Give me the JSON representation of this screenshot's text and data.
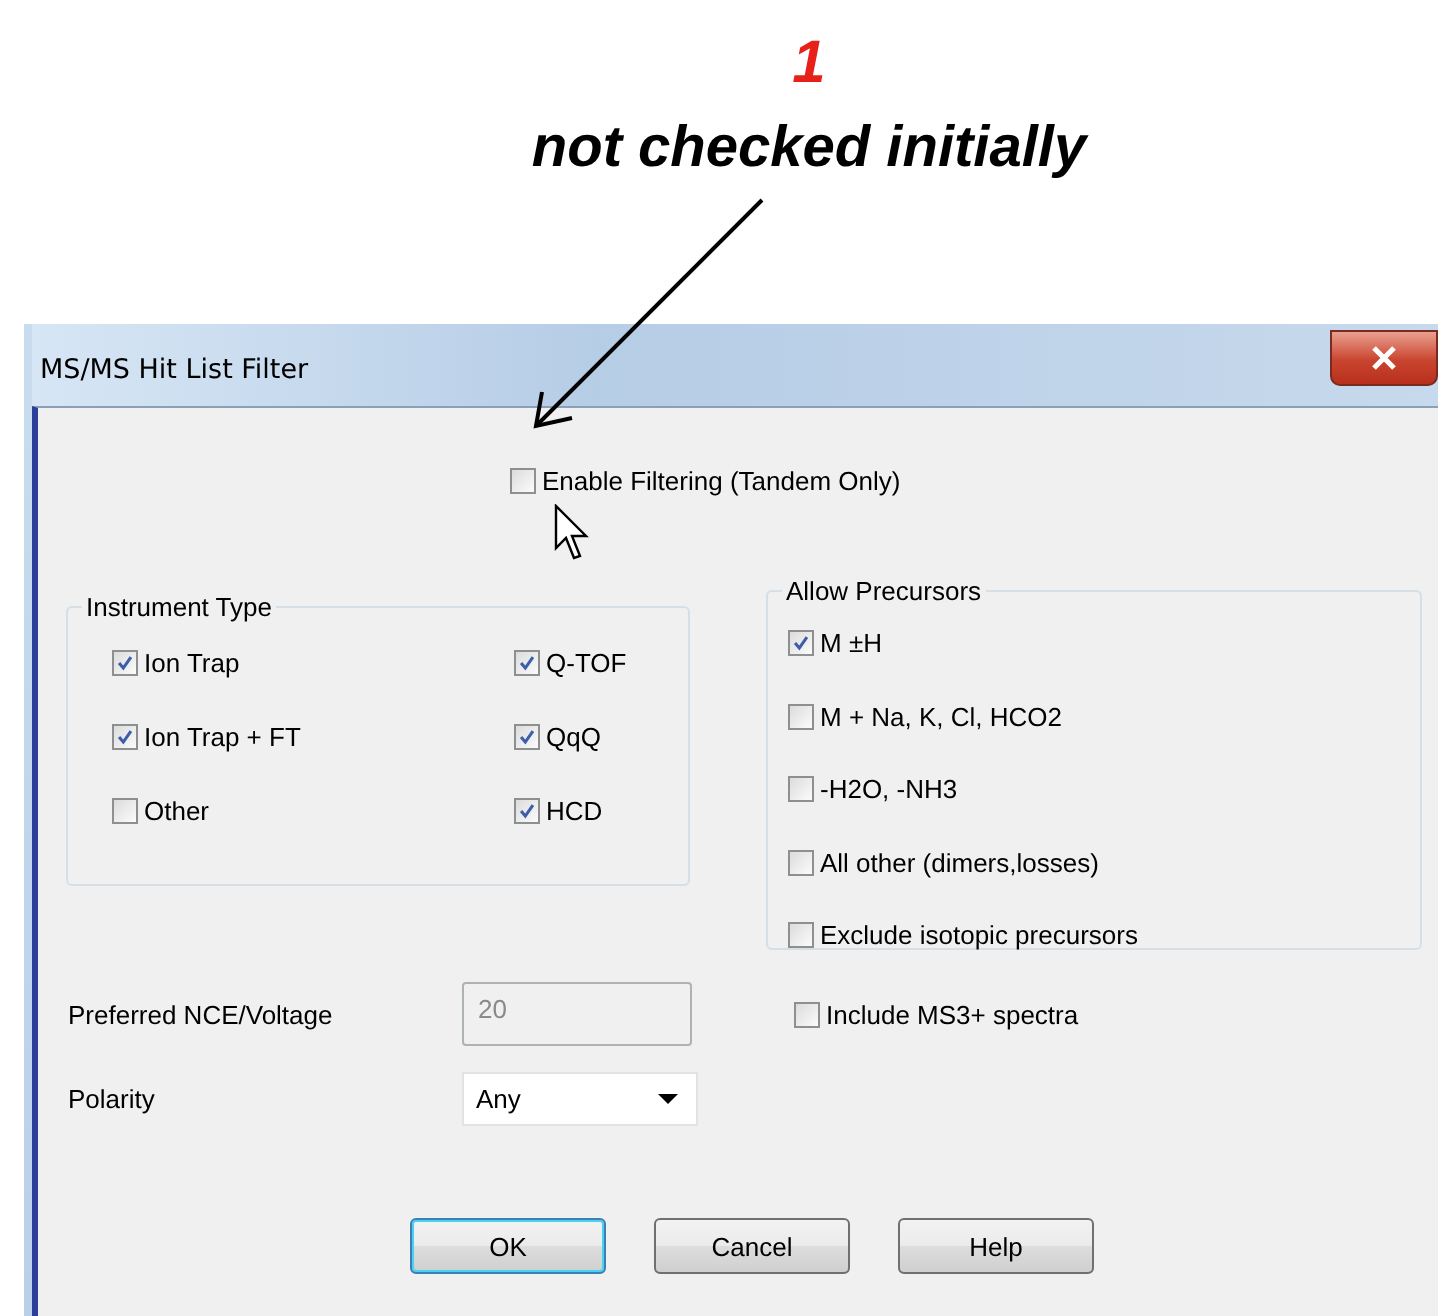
{
  "annotation": {
    "number": "1",
    "note": "not checked initially"
  },
  "window": {
    "title": "MS/MS Hit List Filter"
  },
  "enable_filtering": {
    "label": "Enable Filtering (Tandem Only)",
    "checked": false
  },
  "instrument_type": {
    "title": "Instrument Type",
    "options": [
      {
        "label": "Ion Trap",
        "checked": true
      },
      {
        "label": "Q-TOF",
        "checked": true
      },
      {
        "label": "Ion Trap + FT",
        "checked": true
      },
      {
        "label": "QqQ",
        "checked": true
      },
      {
        "label": "Other",
        "checked": false
      },
      {
        "label": "HCD",
        "checked": true
      }
    ]
  },
  "allow_precursors": {
    "title": "Allow Precursors",
    "options": [
      {
        "label": "M ±H",
        "checked": true
      },
      {
        "label": "M + Na, K, Cl, HCO2",
        "checked": false
      },
      {
        "label": "-H2O, -NH3",
        "checked": false
      },
      {
        "label": "All other (dimers,losses)",
        "checked": false
      },
      {
        "label": "Exclude isotopic precursors",
        "checked": false
      }
    ]
  },
  "nce": {
    "label": "Preferred NCE/Voltage",
    "value": "20",
    "disabled": true
  },
  "include_ms3": {
    "label": "Include MS3+ spectra",
    "checked": false
  },
  "polarity": {
    "label": "Polarity",
    "value": "Any"
  },
  "buttons": [
    {
      "label": "OK",
      "default": true
    },
    {
      "label": "Cancel",
      "default": false
    },
    {
      "label": "Help",
      "default": false
    }
  ]
}
